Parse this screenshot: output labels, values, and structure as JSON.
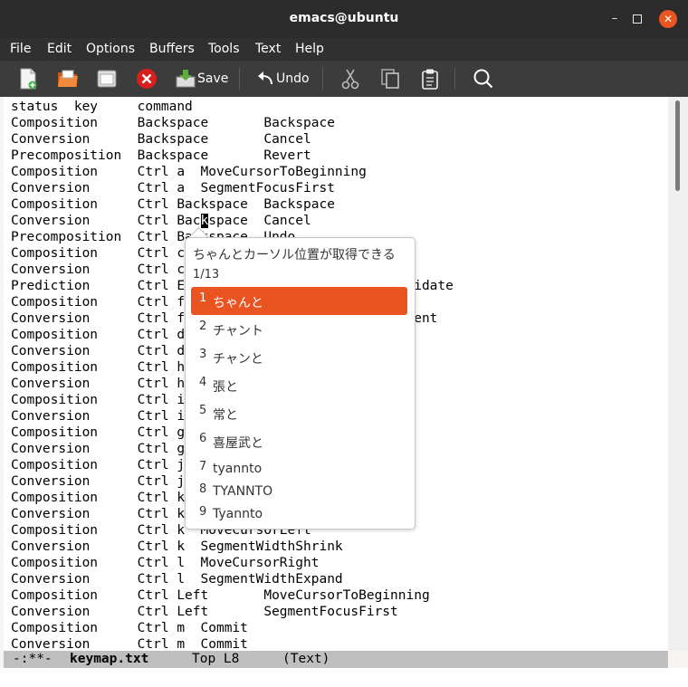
{
  "window": {
    "title": "emacs@ubuntu",
    "min_glyph": "–",
    "close_glyph": "✕"
  },
  "menu": [
    "File",
    "Edit",
    "Options",
    "Buffers",
    "Tools",
    "Text",
    "Help"
  ],
  "toolbar": {
    "save_label": "Save",
    "undo_label": "Undo",
    "icons": [
      "new-file-icon",
      "open-folder-icon",
      "dired-icon",
      "close-buffer-icon",
      "save-icon",
      "undo-icon",
      "cut-icon",
      "copy-icon",
      "paste-icon",
      "search-icon"
    ]
  },
  "buffer": {
    "lines": [
      "status  key     command",
      "Composition     Backspace       Backspace",
      "Conversion      Backspace       Cancel",
      "Precomposition  Backspace       Revert",
      "Composition     Ctrl a  MoveCursorToBeginning",
      "Conversion      Ctrl a  SegmentFocusFirst",
      "Composition     Ctrl Backspace  Backspace",
      "Conversion      Ctrl Backspace  Cancel",
      "Precomposition  Ctrl Backspace  Undo",
      "Composition     Ctrl c",
      "Conversion      Ctrl c",
      "Prediction      Ctrl Enter                       ndidate",
      "Composition     Ctrl f",
      "Conversion      Ctrl f                          egment",
      "Composition     Ctrl d",
      "Conversion      Ctrl d",
      "Composition     Ctrl h",
      "Conversion      Ctrl h",
      "Composition     Ctrl i",
      "Conversion      Ctrl i",
      "Composition     Ctrl g",
      "Conversion      Ctrl g",
      "Composition     Ctrl j",
      "Conversion      Ctrl j",
      "Composition     Ctrl k",
      "Conversion      Ctrl k",
      "Composition     Ctrl k  MoveCursorLeft",
      "Conversion      Ctrl k  SegmentWidthShrink",
      "Composition     Ctrl l  MoveCursorRight",
      "Conversion      Ctrl l  SegmentWidthExpand",
      "Composition     Ctrl Left       MoveCursorToBeginning",
      "Conversion      Ctrl Left       SegmentFocusFirst",
      "Composition     Ctrl m  Commit",
      "Conversion      Ctrl m  Commit"
    ],
    "cursor_line": 7,
    "cursor_col": 24
  },
  "modeline": {
    "status": "-:**-",
    "buffer_name": "keymap.txt",
    "position": "Top L8",
    "mode": "(Text)"
  },
  "ime": {
    "preedit": "ちゃんとカーソル位置が取得できる",
    "pager": "1/13",
    "selected_index": 0,
    "candidates": [
      {
        "num": "1",
        "text": "ちゃんと"
      },
      {
        "num": "2",
        "text": "チャント"
      },
      {
        "num": "3",
        "text": "チャンと"
      },
      {
        "num": "4",
        "text": "張と"
      },
      {
        "num": "5",
        "text": "常と"
      },
      {
        "num": "6",
        "text": "喜屋武と"
      },
      {
        "num": "7",
        "text": "tyannto"
      },
      {
        "num": "8",
        "text": "TYANNTO"
      },
      {
        "num": "9",
        "text": "Tyannto"
      }
    ]
  },
  "colors": {
    "accent": "#e95420",
    "titlebar": "#2b2b2b",
    "menubar": "#303030",
    "toolbar": "#3c3c3c",
    "modeline": "#bfbfbf"
  }
}
